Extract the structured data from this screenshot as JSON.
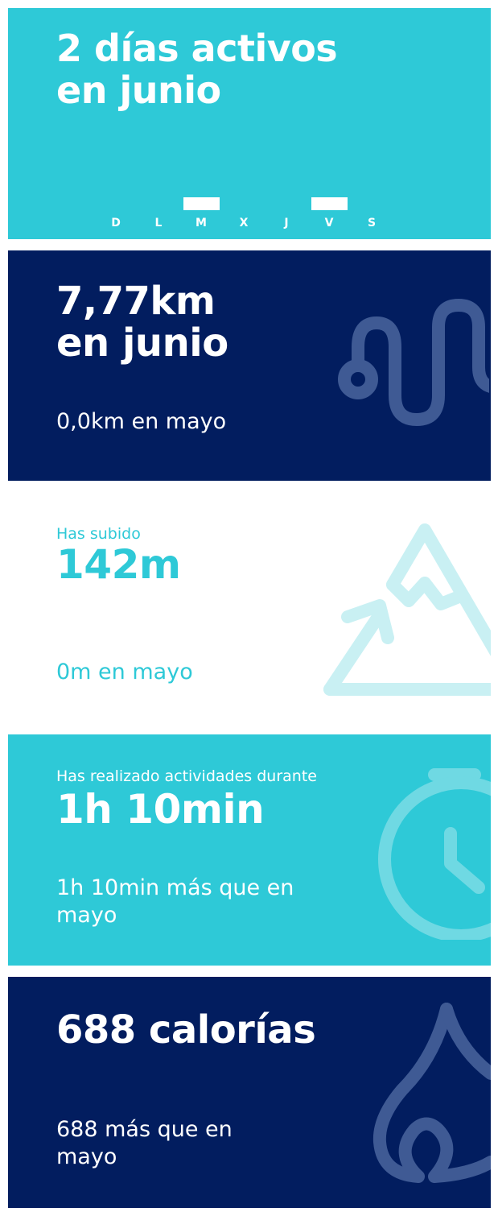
{
  "active_days": {
    "title_line1": "2 días activos",
    "title_line2": "en junio",
    "week": [
      {
        "label": "D",
        "active": false
      },
      {
        "label": "L",
        "active": false
      },
      {
        "label": "M",
        "active": true
      },
      {
        "label": "X",
        "active": false
      },
      {
        "label": "J",
        "active": false
      },
      {
        "label": "V",
        "active": true
      },
      {
        "label": "S",
        "active": false
      }
    ]
  },
  "distance": {
    "value_line": "7,77km",
    "period_line": "en junio",
    "comparison": "0,0km en mayo",
    "icon": "route-icon"
  },
  "climb": {
    "label": "Has subido",
    "value": "142m",
    "comparison": "0m en mayo",
    "icon": "mountain-icon"
  },
  "active_time": {
    "label": "Has realizado actividades durante",
    "value": "1h 10min",
    "comparison": "1h 10min más que en mayo",
    "icon": "stopwatch-icon"
  },
  "calories": {
    "value": "688 calorías",
    "comparison": "688 más que en mayo",
    "icon": "flame-icon"
  },
  "colors": {
    "cyan": "#2ec9d7",
    "navy": "#021d5f",
    "navy_icon": "#3f5a94",
    "light_cyan_icon": "#c9f0f3",
    "cyan_icon": "#6fd9e3"
  }
}
